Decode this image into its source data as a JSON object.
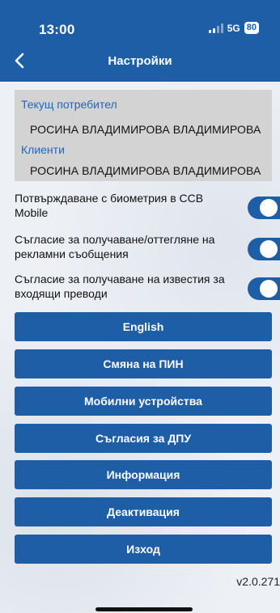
{
  "status_bar": {
    "time": "13:00",
    "network": "5G",
    "battery": "80"
  },
  "header": {
    "title": "Настройки",
    "back_icon": "chevron-left-icon"
  },
  "user_panel": {
    "current_user_label": "Текущ потребител",
    "current_user_value": "РОСИНА ВЛАДИМИРОВА ВЛАДИМИРОВА",
    "clients_label": "Клиенти",
    "clients_value": "РОСИНА ВЛАДИМИРОВА ВЛАДИМИРОВА"
  },
  "toggles": [
    {
      "label": "Потвърждаване с биометрия в CCB Mobile",
      "on": true
    },
    {
      "label": "Съгласие за получаване/оттегляне на рекламни съобщения",
      "on": true
    },
    {
      "label": "Съгласие за получаване на известия за входящи преводи",
      "on": true
    }
  ],
  "buttons": [
    {
      "label": "English"
    },
    {
      "label": "Смяна на ПИН"
    },
    {
      "label": "Мобилни устройства"
    },
    {
      "label": "Съгласия за ДПУ"
    },
    {
      "label": "Информация"
    },
    {
      "label": "Деактивация"
    },
    {
      "label": "Изход"
    }
  ],
  "version": "v2.0.271",
  "colors": {
    "brand": "#1d5ea7",
    "label_blue": "#2466b6",
    "panel_gray": "#d3d3d3"
  }
}
